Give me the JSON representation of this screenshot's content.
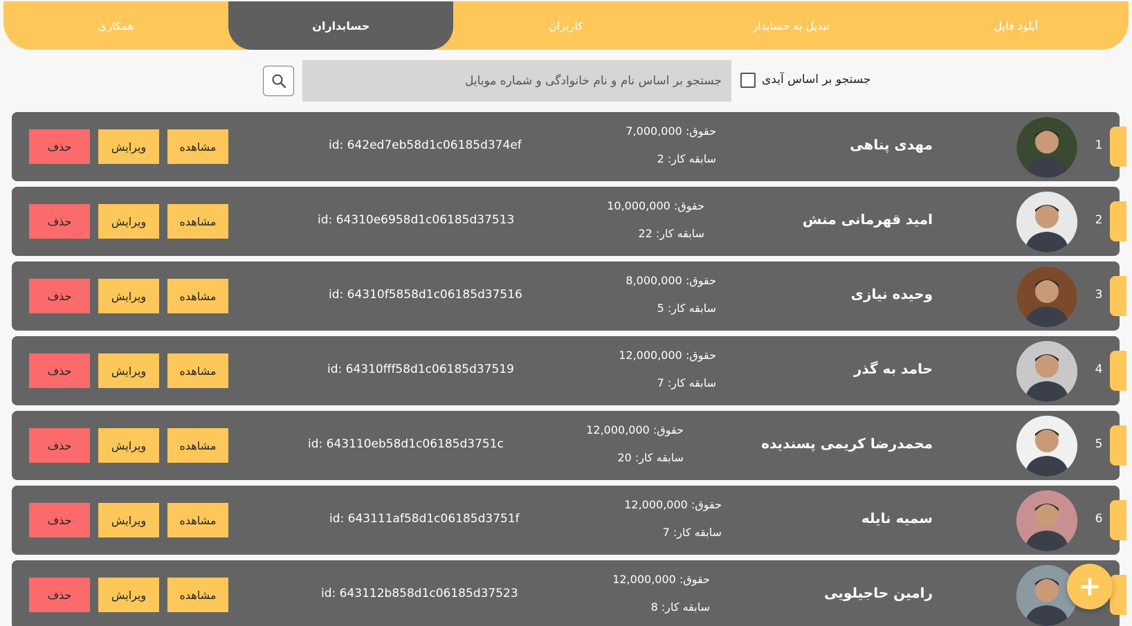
{
  "nav": {
    "tabs": [
      {
        "label": "آپلود فایل",
        "active": false
      },
      {
        "label": "تبدیل به حسابدار",
        "active": false
      },
      {
        "label": "کاربران",
        "active": false
      },
      {
        "label": "حسابداران",
        "active": true
      },
      {
        "label": "همکاری",
        "active": false
      }
    ]
  },
  "search": {
    "checkbox_label": "جستجو بر اساس آیدی",
    "checkbox_checked": false,
    "placeholder": "جستجو بر اساس نام و نام خانوادگی و شماره موبایل",
    "button_icon": "search-icon"
  },
  "labels": {
    "salary_prefix": "حقوق:",
    "experience_prefix": "سابقه کار:",
    "view": "مشاهده",
    "edit": "ویرایش",
    "delete": "حذف"
  },
  "accountants": [
    {
      "index": "1",
      "name": "مهدی پناهی",
      "salary": "7,000,000",
      "experience": "2",
      "id": "id: 642ed7eb58d1c06185d374ef"
    },
    {
      "index": "2",
      "name": "امید قهرمانی منش",
      "salary": "10,000,000",
      "experience": "22",
      "id": "id: 64310e6958d1c06185d37513"
    },
    {
      "index": "3",
      "name": "وحیده نیازی",
      "salary": "8,000,000",
      "experience": "5",
      "id": "id: 64310f5858d1c06185d37516"
    },
    {
      "index": "4",
      "name": "حامد  به گذر",
      "salary": "12,000,000",
      "experience": "7",
      "id": "id: 64310fff58d1c06185d37519"
    },
    {
      "index": "5",
      "name": "محمدرضا  کریمی پسندیده",
      "salary": "12,000,000",
      "experience": "20",
      "id": "id: 643110eb58d1c06185d3751c"
    },
    {
      "index": "6",
      "name": "سمیه نایله",
      "salary": "12,000,000",
      "experience": "7",
      "id": "id: 643111af58d1c06185d3751f"
    },
    {
      "index": "7",
      "name": "رامین حاجیلویی",
      "salary": "12,000,000",
      "experience": "8",
      "id": "id: 643112b858d1c06185d37523"
    }
  ],
  "fab": {
    "icon": "plus-icon",
    "glyph": "+"
  },
  "colors": {
    "accent": "#fdc75a",
    "row_bg": "#646464",
    "delete": "#fb6b6b",
    "active_tab": "#5f5f5f"
  }
}
